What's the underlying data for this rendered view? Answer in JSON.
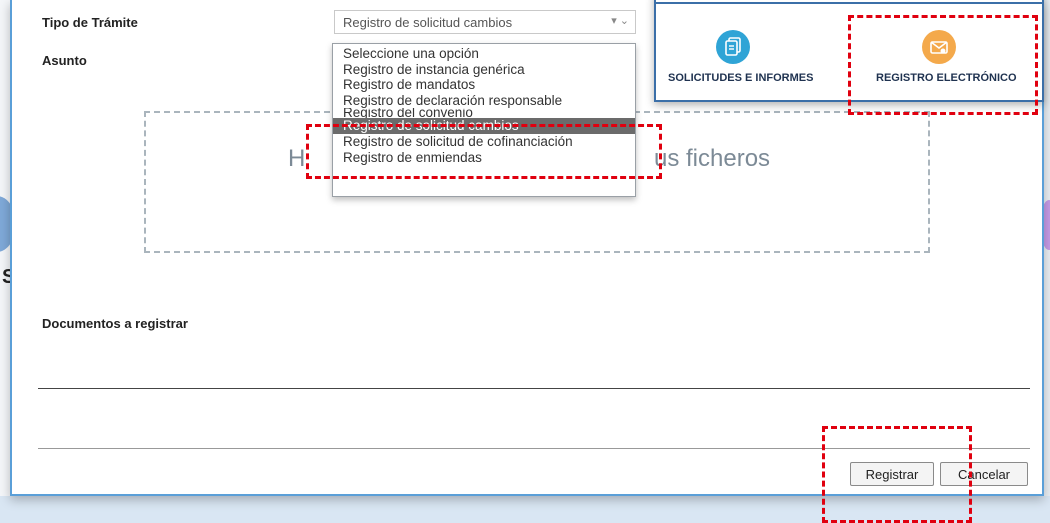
{
  "form": {
    "tipo_label": "Tipo de Trámite",
    "asunto_label": "Asunto",
    "documentos_label": "Documentos a registrar",
    "select_value": "Registro de solicitud cambios"
  },
  "dropdown": {
    "options": [
      "Seleccione una opción",
      "Registro de instancia genérica",
      "Registro de mandatos",
      "Registro de declaración responsable",
      "Registro del convenio",
      "Registro de solicitud cambios",
      "Registro de solicitud de cofinanciación",
      "Registro de enmiendas"
    ],
    "selected_index": 5
  },
  "dropzone": {
    "text_left": "H",
    "text_right": "us ficheros"
  },
  "buttons": {
    "registrar": "Registrar",
    "cancelar": "Cancelar"
  },
  "panel": {
    "solicitudes": "SOLICITUDES E INFORMES",
    "registro": "REGISTRO ELECTRÓNICO",
    "solicitudes_icon": "documents-icon",
    "registro_icon": "envelope-icon",
    "solicitudes_color": "#2fa4d6",
    "registro_color": "#f4a94b"
  },
  "background": {
    "left_letter": "S"
  },
  "annotation_color": "#e0000f"
}
